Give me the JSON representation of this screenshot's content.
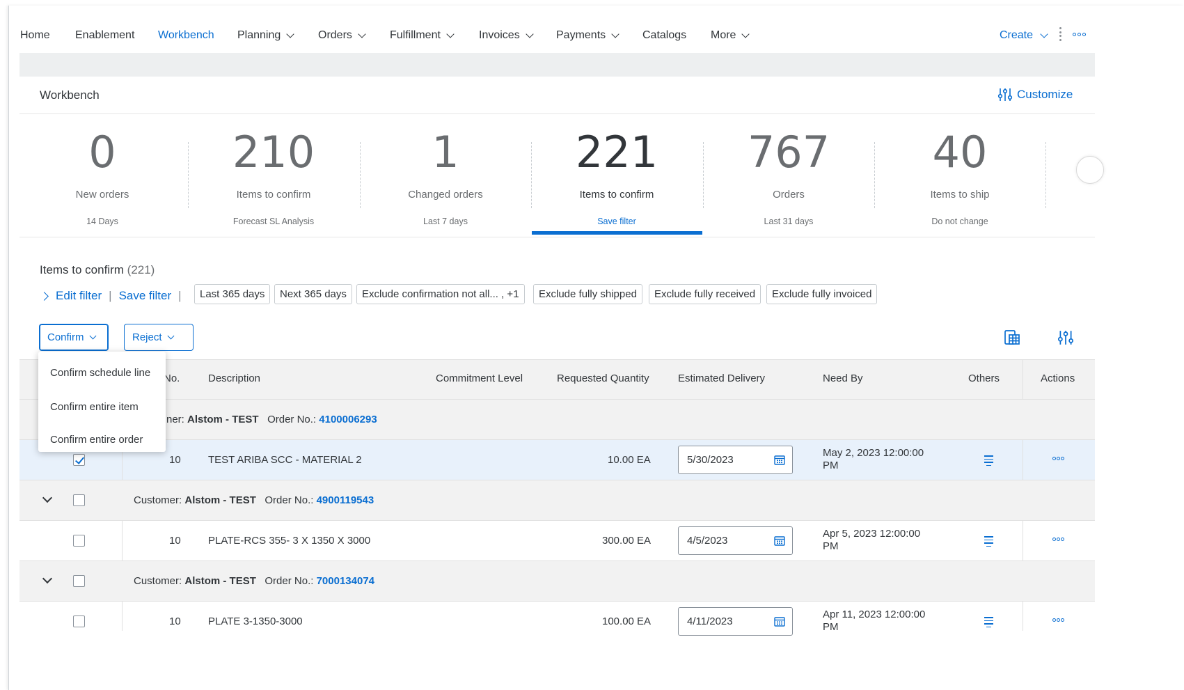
{
  "nav": {
    "items": [
      {
        "label": "Home",
        "dropdown": false
      },
      {
        "label": "Enablement",
        "dropdown": false
      },
      {
        "label": "Workbench",
        "dropdown": false,
        "active": true
      },
      {
        "label": "Planning",
        "dropdown": true
      },
      {
        "label": "Orders",
        "dropdown": true
      },
      {
        "label": "Fulfillment",
        "dropdown": true
      },
      {
        "label": "Invoices",
        "dropdown": true
      },
      {
        "label": "Payments",
        "dropdown": true
      },
      {
        "label": "Catalogs",
        "dropdown": false
      },
      {
        "label": "More",
        "dropdown": true
      }
    ],
    "create_label": "Create"
  },
  "workbench": {
    "title": "Workbench",
    "customize_label": "Customize"
  },
  "tiles": [
    {
      "value": "0",
      "label": "New orders",
      "sub": "14 Days"
    },
    {
      "value": "210",
      "label": "Items to confirm",
      "sub": "Forecast SL Analysis"
    },
    {
      "value": "1",
      "label": "Changed orders",
      "sub": "Last 7 days"
    },
    {
      "value": "221",
      "label": "Items to confirm",
      "sub": "Save filter",
      "active": true
    },
    {
      "value": "767",
      "label": "Orders",
      "sub": "Last 31 days"
    },
    {
      "value": "40",
      "label": "Items to ship",
      "sub": "Do not change"
    }
  ],
  "items": {
    "title": "Items to confirm",
    "count": "(221)",
    "edit_filter": "Edit filter",
    "save_filter": "Save filter",
    "chips": [
      "Last 365 days",
      "Next 365 days",
      "Exclude confirmation not all... , +1",
      "Exclude fully shipped",
      "Exclude fully received",
      "Exclude fully invoiced"
    ]
  },
  "toolbar": {
    "confirm_label": "Confirm",
    "reject_label": "Reject"
  },
  "dropdown": {
    "items": [
      "Confirm schedule line",
      "Confirm entire item",
      "Confirm entire order"
    ]
  },
  "table": {
    "headers": {
      "line_no": "No.",
      "description": "Description",
      "commitment": "Commitment Level",
      "req_qty": "Requested Quantity",
      "est_delivery": "Estimated Delivery",
      "need_by": "Need By",
      "others": "Others",
      "actions": "Actions"
    },
    "groups": [
      {
        "customer_prefix": "ner:",
        "customer_label": "Customer:",
        "customer": "Alstom - TEST",
        "order_label": "Order No.:",
        "order_no": "4100006293",
        "item": {
          "line": "10",
          "description": "TEST ARIBA SCC - MATERIAL 2",
          "qty": "10.00 EA",
          "est_delivery": "5/30/2023",
          "need_by_1": "May 2, 2023 12:00:00",
          "need_by_2": "PM",
          "checked": true
        }
      },
      {
        "customer_label": "Customer:",
        "customer": "Alstom - TEST",
        "order_label": "Order No.:",
        "order_no": "4900119543",
        "item": {
          "line": "10",
          "description": "PLATE-RCS 355- 3 X 1350 X 3000",
          "qty": "300.00 EA",
          "est_delivery": "4/5/2023",
          "need_by_1": "Apr 5, 2023 12:00:00",
          "need_by_2": "PM",
          "checked": false
        }
      },
      {
        "customer_label": "Customer:",
        "customer": "Alstom - TEST",
        "order_label": "Order No.:",
        "order_no": "7000134074",
        "item": {
          "line": "10",
          "description": "PLATE 3-1350-3000",
          "qty": "100.00 EA",
          "est_delivery": "4/11/2023",
          "need_by_1": "Apr 11, 2023 12:00:00",
          "need_by_2": "PM",
          "checked": false
        }
      }
    ]
  },
  "colors": {
    "accent": "#0a6ed1",
    "text": "#32363a",
    "muted": "#6a6d70",
    "header_bg": "#f2f2f2",
    "selected_row": "#e8f1fb"
  }
}
